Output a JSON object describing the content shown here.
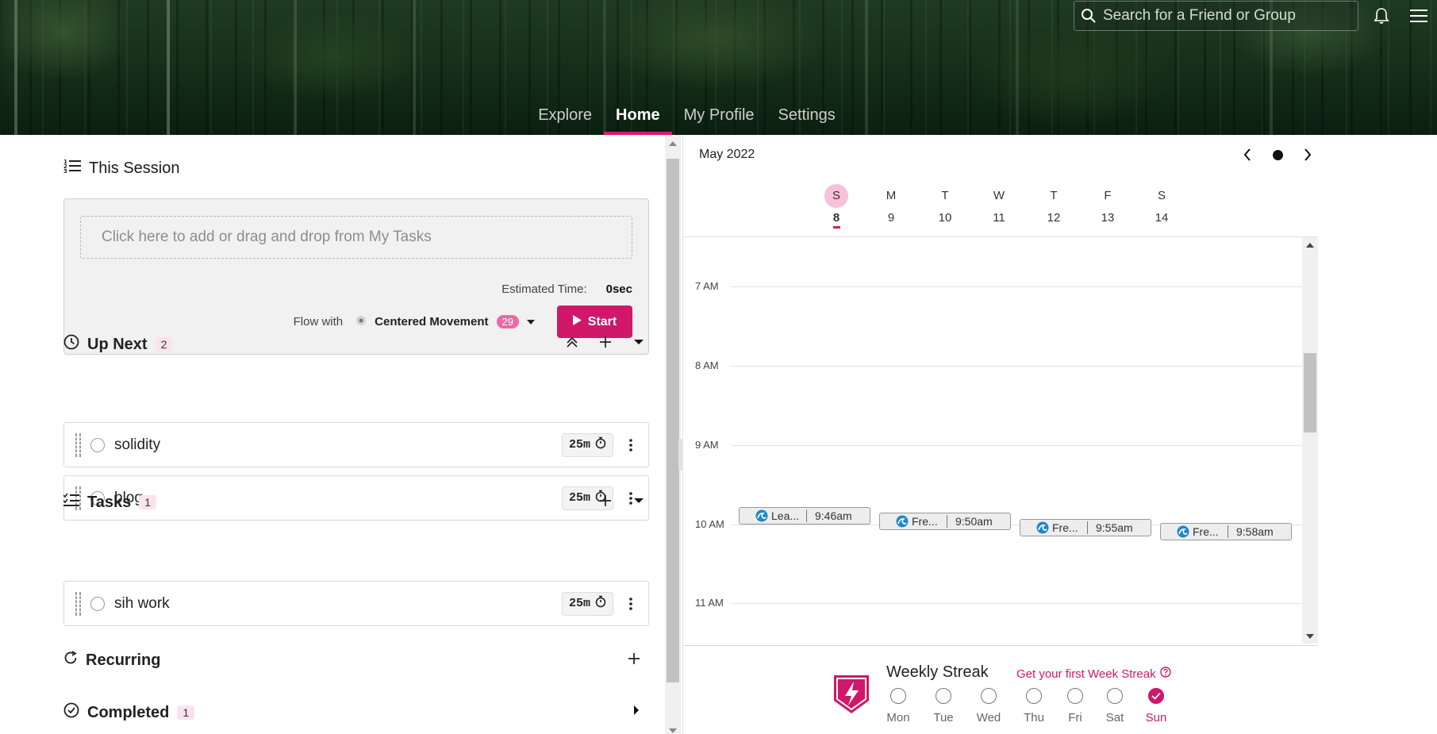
{
  "header": {
    "search_placeholder": "Search for a Friend or Group",
    "nav_tabs": [
      {
        "label": "Explore",
        "active": false
      },
      {
        "label": "Home",
        "active": true
      },
      {
        "label": "My Profile",
        "active": false
      },
      {
        "label": "Settings",
        "active": false
      }
    ]
  },
  "colors": {
    "accent": "#d0176a",
    "badge_bg": "#fbe3ee",
    "today_bg": "#f5c2d9"
  },
  "session": {
    "title": "This Session",
    "dropzone_text": "Click here to add or drag and drop from My Tasks",
    "estimated_label": "Estimated Time:",
    "estimated_value": "0sec",
    "flow_label": "Flow with",
    "music_name": "Centered Movement",
    "music_count": "29",
    "start_label": "Start"
  },
  "up_next": {
    "title": "Up Next",
    "count": "2",
    "tasks": [
      {
        "name": "solidity",
        "duration": "25m"
      },
      {
        "name": "blog",
        "duration": "25m"
      }
    ]
  },
  "tasks": {
    "title": "Tasks",
    "count": "1",
    "items": [
      {
        "name": "sih work",
        "duration": "25m"
      }
    ]
  },
  "recurring": {
    "title": "Recurring"
  },
  "completed": {
    "title": "Completed",
    "count": "1"
  },
  "calendar": {
    "month": "May 2022",
    "days": [
      {
        "name": "S",
        "date": "8",
        "today": true
      },
      {
        "name": "M",
        "date": "9",
        "today": false
      },
      {
        "name": "T",
        "date": "10",
        "today": false
      },
      {
        "name": "W",
        "date": "11",
        "today": false
      },
      {
        "name": "T",
        "date": "12",
        "today": false
      },
      {
        "name": "F",
        "date": "13",
        "today": false
      },
      {
        "name": "S",
        "date": "14",
        "today": false
      }
    ],
    "hours": [
      "7 AM",
      "8 AM",
      "9 AM",
      "10 AM",
      "11 AM"
    ],
    "events": [
      {
        "label": "Lea...",
        "time": "9:46am"
      },
      {
        "label": "Fre...",
        "time": "9:50am"
      },
      {
        "label": "Fre...",
        "time": "9:55am"
      },
      {
        "label": "Fre...",
        "time": "9:58am"
      }
    ]
  },
  "streak": {
    "title": "Weekly Streak",
    "link_text": "Get your first Week Streak",
    "days": [
      {
        "label": "Mon",
        "done": false
      },
      {
        "label": "Tue",
        "done": false
      },
      {
        "label": "Wed",
        "done": false
      },
      {
        "label": "Thu",
        "done": false
      },
      {
        "label": "Fri",
        "done": false
      },
      {
        "label": "Sat",
        "done": false
      },
      {
        "label": "Sun",
        "done": true
      }
    ]
  }
}
